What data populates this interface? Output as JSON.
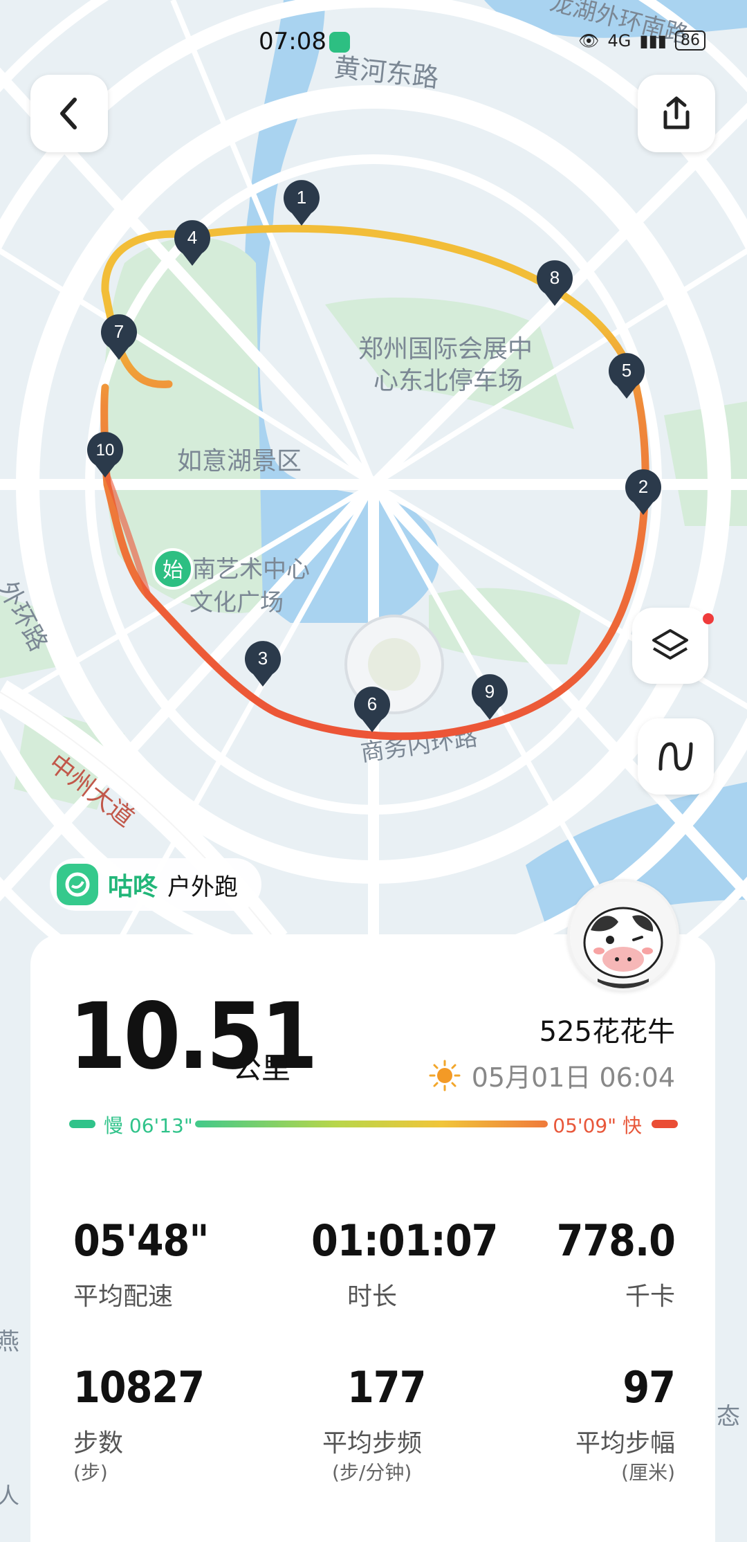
{
  "status_bar": {
    "time": "07:08",
    "network": "4G",
    "battery": "86"
  },
  "map": {
    "labels": {
      "road_north": "黄河东路",
      "road_northeast": "龙湖外环南路",
      "road_west": "外环路",
      "road_southwest": "中州大道",
      "road_south": "商务内环路",
      "poi_parking_line1": "郑州国际会展中",
      "poi_parking_line2": "心东北停车场",
      "poi_lake": "如意湖景区",
      "poi_art_line1": "南艺术中心",
      "poi_art_line2": "文化广场",
      "edge_left": "燕",
      "edge_right": "态",
      "edge_left_bottom": "人"
    },
    "start_marker": "始",
    "km_markers": [
      "1",
      "2",
      "3",
      "4",
      "5",
      "6",
      "7",
      "8",
      "9",
      "10"
    ]
  },
  "buttons": {
    "back_icon": "chevron-left-icon",
    "share_icon": "share-icon",
    "layers_icon": "layers-icon",
    "track_icon": "route-icon"
  },
  "brand": {
    "name": "咕咚",
    "mode": "户外跑"
  },
  "summary": {
    "distance": "10.51",
    "distance_unit": "公里",
    "username": "525花花牛",
    "date": "05月01日 06:04",
    "weather_icon": "sun-icon"
  },
  "pace_legend": {
    "slow": "慢 06'13\"",
    "fast": "05'09\" 快"
  },
  "stats": [
    {
      "value": "05'48\"",
      "label": "平均配速",
      "unit": ""
    },
    {
      "value": "01:01:07",
      "label": "时长",
      "unit": ""
    },
    {
      "value": "778.0",
      "label": "千卡",
      "unit": ""
    },
    {
      "value": "10827",
      "label": "步数",
      "unit": "(步)"
    },
    {
      "value": "177",
      "label": "平均步频",
      "unit": "(步/分钟)"
    },
    {
      "value": "97",
      "label": "平均步幅",
      "unit": "(厘米)"
    }
  ],
  "colors": {
    "route_fast": "#ec5b3a",
    "route_slow": "#f2bd38",
    "brand_green": "#2dbf82",
    "marker": "#2b3a4b"
  }
}
